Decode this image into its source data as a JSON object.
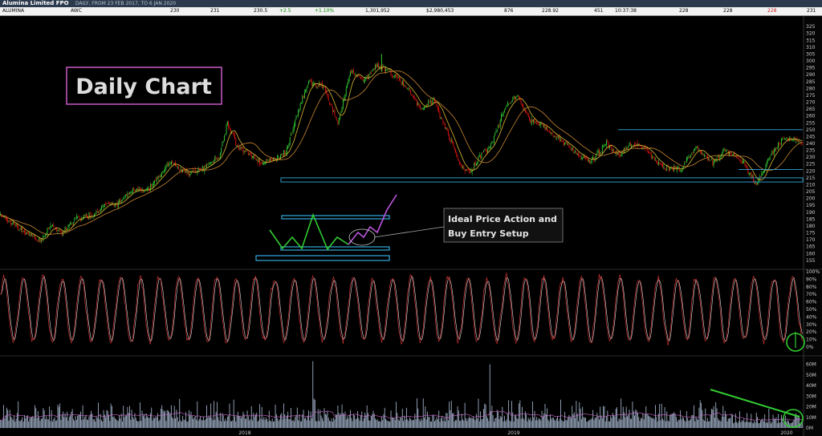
{
  "window": {
    "title": "Alumina Limited FPO",
    "subtitle": "DAILY, FROM 23 FEB 2017, TO 6 JAN 2020"
  },
  "quote_bar": {
    "symbol": "ALUMINA",
    "code": "AWC",
    "open": "230",
    "high": "231",
    "last": "230.5",
    "change": "+2.5",
    "change_pct": "+1.10%",
    "volume": "1,301,952",
    "value": "$2,980,453",
    "trades": "876",
    "vwap": "228.92",
    "count": "451",
    "time": "10:37:38",
    "bid": "228",
    "ask": "228",
    "low": "228",
    "extra": "231"
  },
  "annotations": {
    "daily_chart_label": "Daily Chart",
    "callout_line1": "Ideal Price Action and",
    "callout_line2": "Buy Entry Setup"
  },
  "colors": {
    "background": "#000000",
    "bull_candle": "#33cc33",
    "bear_candle": "#dd1111",
    "ma_fast": "#ddbb33",
    "ma_slow": "#cc8833",
    "rect_cyan": "#33aadd",
    "label_border": "#bb55bb",
    "zigzag_green": "#33cc33",
    "zigzag_purple": "#bb55dd",
    "stoch_k": "#cc3333",
    "stoch_d": "#dddddd",
    "volume": "#9aaac0",
    "volume_ma": "#cc66cc",
    "trend_green": "#33cc33"
  },
  "chart_data": [
    {
      "type": "candlestick",
      "panel": "price",
      "x_ticks": [
        "2018",
        "2019",
        "2020"
      ],
      "y_ticks": [
        155,
        160,
        165,
        170,
        175,
        180,
        185,
        190,
        195,
        200,
        205,
        210,
        215,
        220,
        225,
        230,
        235,
        240,
        245,
        250,
        255,
        260,
        265,
        270,
        275,
        280,
        285,
        290,
        295,
        300,
        305,
        310,
        315,
        320,
        325
      ],
      "ylim": [
        152,
        328
      ],
      "series_anchors": [
        [
          0,
          188
        ],
        [
          12,
          181
        ],
        [
          25,
          175
        ],
        [
          38,
          169
        ],
        [
          48,
          180
        ],
        [
          60,
          175
        ],
        [
          72,
          186
        ],
        [
          88,
          187
        ],
        [
          100,
          196
        ],
        [
          112,
          196
        ],
        [
          125,
          205
        ],
        [
          140,
          206
        ],
        [
          150,
          214
        ],
        [
          162,
          226
        ],
        [
          180,
          218
        ],
        [
          195,
          222
        ],
        [
          210,
          231
        ],
        [
          218,
          255
        ],
        [
          228,
          237
        ],
        [
          240,
          232
        ],
        [
          250,
          225
        ],
        [
          262,
          228
        ],
        [
          275,
          235
        ],
        [
          285,
          262
        ],
        [
          296,
          285
        ],
        [
          310,
          281
        ],
        [
          324,
          255
        ],
        [
          336,
          292
        ],
        [
          350,
          286
        ],
        [
          362,
          297
        ],
        [
          378,
          291
        ],
        [
          392,
          278
        ],
        [
          404,
          265
        ],
        [
          416,
          272
        ],
        [
          430,
          247
        ],
        [
          440,
          227
        ],
        [
          450,
          218
        ],
        [
          460,
          230
        ],
        [
          472,
          240
        ],
        [
          484,
          265
        ],
        [
          496,
          275
        ],
        [
          508,
          257
        ],
        [
          520,
          254
        ],
        [
          532,
          245
        ],
        [
          544,
          239
        ],
        [
          556,
          230
        ],
        [
          568,
          228
        ],
        [
          582,
          240
        ],
        [
          595,
          231
        ],
        [
          605,
          240
        ],
        [
          618,
          238
        ],
        [
          630,
          227
        ],
        [
          642,
          221
        ],
        [
          654,
          222
        ],
        [
          668,
          237
        ],
        [
          684,
          226
        ],
        [
          696,
          235
        ],
        [
          712,
          227
        ],
        [
          726,
          210
        ],
        [
          740,
          232
        ],
        [
          752,
          244
        ],
        [
          762,
          243
        ],
        [
          770,
          240
        ]
      ],
      "support_zone": [
        212,
        215
      ],
      "resistance_line": 250,
      "inner_support": 221,
      "notable_highs": [
        305,
        298,
        275
      ],
      "notable_lows": [
        168,
        207,
        211
      ]
    },
    {
      "type": "line",
      "panel": "stochastic",
      "y_ticks": [
        "100%",
        "90%",
        "80%",
        "70%",
        "60%",
        "50%",
        "40%",
        "30%",
        "20%",
        "10%",
        "0%"
      ],
      "ylim": [
        0,
        100
      ],
      "series": [
        {
          "name": "%K",
          "color": "#cc3333"
        },
        {
          "name": "%D",
          "color": "#dddddd"
        }
      ],
      "last_value": 8
    },
    {
      "type": "bar",
      "panel": "volume",
      "y_ticks": [
        "60M",
        "50M",
        "40M",
        "30M",
        "20M",
        "10M",
        "0M"
      ],
      "ylim": [
        0,
        65
      ],
      "typical_range": [
        3,
        20
      ],
      "spikes": [
        {
          "index": 300,
          "value": 63
        },
        {
          "index": 470,
          "value": 60
        }
      ],
      "trend": "declining"
    }
  ]
}
